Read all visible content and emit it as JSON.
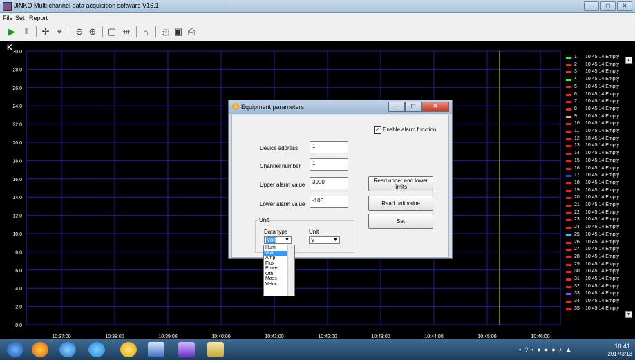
{
  "window": {
    "title": "JINKO Multi channel data acquisition software V16.1",
    "buttons": [
      "—",
      "▢",
      "✕"
    ]
  },
  "menu": [
    "File",
    "Set",
    "Report"
  ],
  "chart_data": {
    "type": "line",
    "ylabel": "K",
    "ylim": [
      0.0,
      30.0
    ],
    "y_ticks": [
      "30.0",
      "28.0",
      "26.0",
      "24.0",
      "22.0",
      "20.0",
      "18.0",
      "16.0",
      "14.0",
      "12.0",
      "10.0",
      "8.0",
      "6.0",
      "4.0",
      "2.0",
      "0.0"
    ],
    "x_ticks": [
      "10:37:00",
      "10:38:00",
      "10:39:00",
      "10:40:00",
      "10:41:00",
      "10:42:00",
      "10:43:00",
      "10:44:00",
      "10:45:00",
      "10:46:00"
    ],
    "grid": true,
    "cursor_time": "10:45:14",
    "series": []
  },
  "legend": {
    "items": [
      {
        "num": "1",
        "text": "10:45:14 Empty",
        "color": "#33ff33"
      },
      {
        "num": "2",
        "text": "10:45:14 Empty",
        "color": "#ff2222"
      },
      {
        "num": "3",
        "text": "10:45:14 Empty",
        "color": "#ff2222"
      },
      {
        "num": "4",
        "text": "10:45:14 Empty",
        "color": "#33ff33"
      },
      {
        "num": "5",
        "text": "10:45:14 Empty",
        "color": "#ff2222"
      },
      {
        "num": "6",
        "text": "10:45:14 Empty",
        "color": "#ff2222"
      },
      {
        "num": "7",
        "text": "10:45:14 Empty",
        "color": "#ff2222"
      },
      {
        "num": "8",
        "text": "10:45:14 Empty",
        "color": "#ff2222"
      },
      {
        "num": "9",
        "text": "10:45:14 Empty",
        "color": "#ffaa55"
      },
      {
        "num": "10",
        "text": "10:45:14 Empty",
        "color": "#ff2222"
      },
      {
        "num": "11",
        "text": "10:45:14 Empty",
        "color": "#ff2222"
      },
      {
        "num": "12",
        "text": "10:45:14 Empty",
        "color": "#ff2222"
      },
      {
        "num": "13",
        "text": "10:45:14 Empty",
        "color": "#ff2222"
      },
      {
        "num": "14",
        "text": "10:45:14 Empty",
        "color": "#ff2222"
      },
      {
        "num": "15",
        "text": "10:45:14 Empty",
        "color": "#ff2222"
      },
      {
        "num": "16",
        "text": "10:45:14 Empty",
        "color": "#ff2222"
      },
      {
        "num": "17",
        "text": "10:45:14 Empty",
        "color": "#2244ff"
      },
      {
        "num": "18",
        "text": "10:45:14 Empty",
        "color": "#ff2222"
      },
      {
        "num": "19",
        "text": "10:45:14 Empty",
        "color": "#ff2222"
      },
      {
        "num": "20",
        "text": "10:45:14 Empty",
        "color": "#ff2222"
      },
      {
        "num": "21",
        "text": "10:45:14 Empty",
        "color": "#ff2222"
      },
      {
        "num": "22",
        "text": "10:45:14 Empty",
        "color": "#ff2222"
      },
      {
        "num": "23",
        "text": "10:45:14 Empty",
        "color": "#ff2222"
      },
      {
        "num": "24",
        "text": "10:45:14 Empty",
        "color": "#ff2222"
      },
      {
        "num": "25",
        "text": "10:45:14 Empty",
        "color": "#33ccff"
      },
      {
        "num": "26",
        "text": "10:45:14 Empty",
        "color": "#ff2222"
      },
      {
        "num": "27",
        "text": "10:45:14 Empty",
        "color": "#ff2222"
      },
      {
        "num": "28",
        "text": "10:45:14 Empty",
        "color": "#ff2222"
      },
      {
        "num": "29",
        "text": "10:45:14 Empty",
        "color": "#ff2222"
      },
      {
        "num": "30",
        "text": "10:45:14 Empty",
        "color": "#ff2222"
      },
      {
        "num": "31",
        "text": "10:45:14 Empty",
        "color": "#ff2222"
      },
      {
        "num": "32",
        "text": "10:45:14 Empty",
        "color": "#ff2222"
      },
      {
        "num": "33",
        "text": "10:45:14 Empty",
        "color": "#8844ff"
      },
      {
        "num": "34",
        "text": "10:45:14 Empty",
        "color": "#ff2222"
      },
      {
        "num": "35",
        "text": "10:45:14 Empty",
        "color": "#ff2222"
      }
    ]
  },
  "dialog": {
    "title": "Equipment parameters",
    "enable_alarm_label": "Enable alarm function",
    "enable_alarm_checked": true,
    "device_address_label": "Device address",
    "device_address_value": "1",
    "channel_number_label": "Channel number",
    "channel_number_value": "1",
    "upper_alarm_label": "Upper alarm value",
    "upper_alarm_value": "3000",
    "lower_alarm_label": "Lower alarm value",
    "lower_alarm_value": "-100",
    "read_limits_label": "Read upper and lower limits",
    "read_unit_label": "Read unit value",
    "set_label": "Set",
    "unit_group_label": "Unit",
    "data_type_label": "Data type",
    "data_type_value": "Volt",
    "unit_label": "Unit",
    "unit_value": "V",
    "data_type_options": [
      "Humi",
      "Volt",
      "Amp",
      "Flux",
      "Power",
      "Oth",
      "Mass",
      "Veloc"
    ],
    "data_type_selected_index": 1
  },
  "taskbar": {
    "clock_time": "10:41",
    "clock_date": "2017/3/13"
  }
}
